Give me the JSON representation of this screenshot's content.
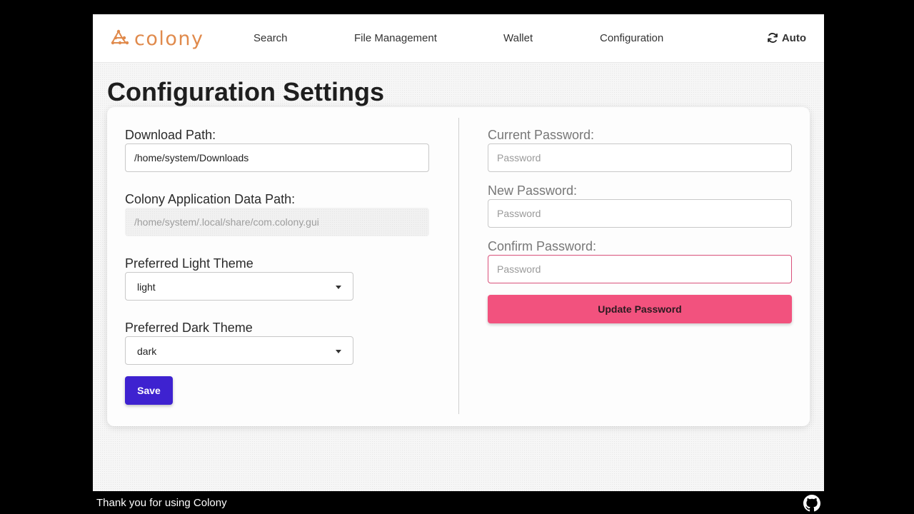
{
  "app": {
    "brand": "colony"
  },
  "nav": {
    "links": [
      "Search",
      "File Management",
      "Wallet",
      "Configuration"
    ],
    "theme_toggle": "Auto"
  },
  "page": {
    "title": "Configuration Settings"
  },
  "settings": {
    "download_path": {
      "label": "Download Path:",
      "value": "/home/system/Downloads"
    },
    "data_path": {
      "label": "Colony Application Data Path:",
      "value": "/home/system/.local/share/com.colony.gui"
    },
    "light_theme": {
      "label": "Preferred Light Theme",
      "value": "light"
    },
    "dark_theme": {
      "label": "Preferred Dark Theme",
      "value": "dark"
    },
    "save_label": "Save"
  },
  "password": {
    "current": {
      "label": "Current Password:",
      "placeholder": "Password"
    },
    "new": {
      "label": "New Password:",
      "placeholder": "Password"
    },
    "confirm": {
      "label": "Confirm Password:",
      "placeholder": "Password"
    },
    "update_label": "Update Password"
  },
  "footer": {
    "text": "Thank you for using Colony"
  },
  "colors": {
    "brand": "#e08a4c",
    "primary": "#3e22d0",
    "accent": "#f2527e",
    "error": "#d9507a"
  },
  "icons": {
    "logo": "colony-logo-icon",
    "theme": "refresh-icon",
    "footer": "github-icon"
  }
}
